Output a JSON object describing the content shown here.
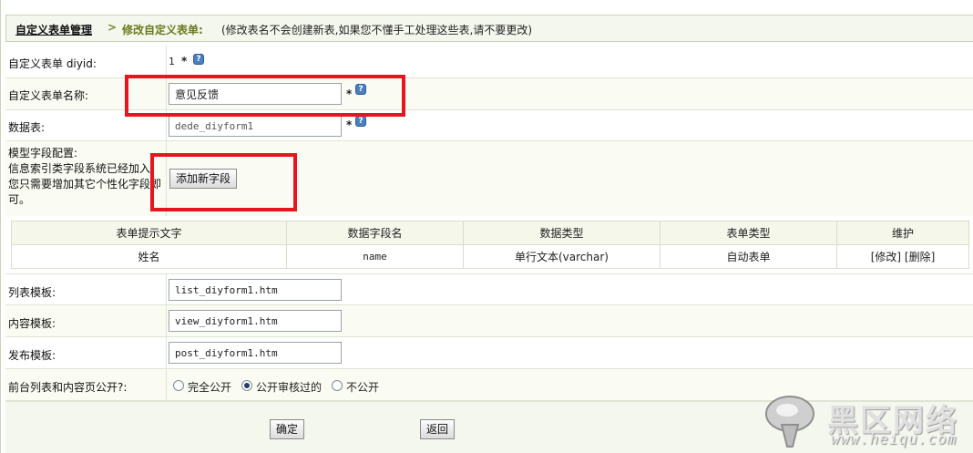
{
  "header": {
    "crumb_main": "自定义表单管理",
    "separator": ">",
    "crumb_current": "修改自定义表单:",
    "note": "(修改表名不会创建新表,如果您不懂手工处理这些表,请不要更改)"
  },
  "form": {
    "diyid": {
      "label": "自定义表单 diyid:",
      "value": "1",
      "required": "*"
    },
    "name": {
      "label": "自定义表单名称:",
      "value": "意见反馈",
      "required": "*"
    },
    "table": {
      "label": "数据表:",
      "value": "dede_diyform1",
      "required": "*"
    },
    "fields_config": {
      "label_lines": [
        "模型字段配置:",
        "信息索引类字段系统已经加入",
        "您只需要增加其它个性化字段即",
        "可。"
      ],
      "add_button": "添加新字段"
    },
    "list_template": {
      "label": "列表模板:",
      "value": "list_diyform1.htm"
    },
    "view_template": {
      "label": "内容模板:",
      "value": "view_diyform1.htm"
    },
    "post_template": {
      "label": "发布模板:",
      "value": "post_diyform1.htm"
    },
    "public": {
      "label": "前台列表和内容页公开?:",
      "options": [
        "完全公开",
        "公开审核过的",
        "不公开"
      ],
      "selected": "公开审核过的"
    },
    "confirm_button": "确定",
    "back_button": "返回"
  },
  "field_table": {
    "headers": [
      "表单提示文字",
      "数据字段名",
      "数据类型",
      "表单类型",
      "维护"
    ],
    "rows": [
      {
        "prompt": "姓名",
        "field": "name",
        "type": "单行文本(varchar)",
        "form_type": "自动表单",
        "edit": "[修改]",
        "delete": "[删除]"
      }
    ]
  },
  "watermark": {
    "title": "黑区网络",
    "url": "www.heiqu.com"
  },
  "colors": {
    "highlight_box": "#e8141e",
    "header_bg": "#f4f7ee",
    "crumb_current": "#6b7a1e"
  },
  "icons": {
    "help": "question-help-icon"
  }
}
